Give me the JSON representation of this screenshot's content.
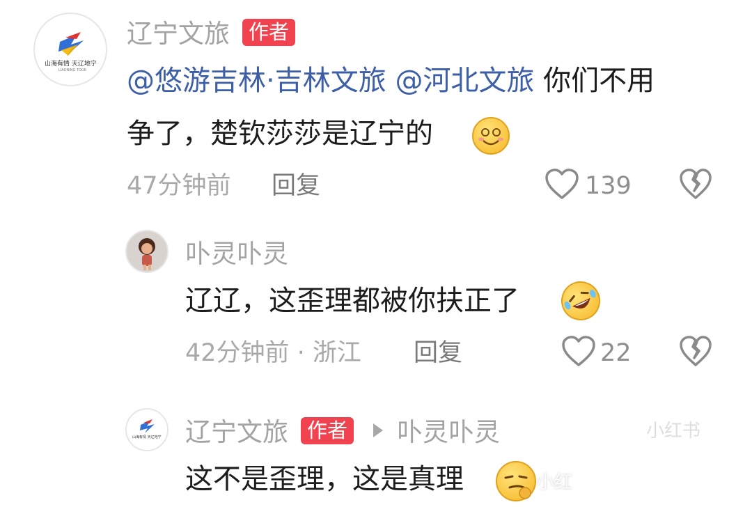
{
  "comment1": {
    "author": "辽宁文旅",
    "badge": "作者",
    "mention1": "@悠游吉林·吉林文旅",
    "mention2": "@河北文旅",
    "text_line1": "你们不用",
    "text_line2": "争了，楚钦莎莎是辽宁的",
    "emoji": "smile-emoji",
    "time": "47分钟前",
    "reply_label": "回复",
    "like_count": "139",
    "avatar_logo_text": "山海有情 天辽地宁",
    "avatar_logo_sub": "LIAONING TOUR"
  },
  "comment2": {
    "author": "卟灵卟灵",
    "text": "辽辽，这歪理都被你扶正了",
    "emoji": "rofl-emoji",
    "time": "42分钟前 · 浙江",
    "reply_label": "回复",
    "like_count": "22"
  },
  "comment3": {
    "author": "辽宁文旅",
    "badge": "作者",
    "reply_to": "卟灵卟灵",
    "text": "这不是歪理，这是真理",
    "emoji": "smirk-emoji",
    "avatar_logo_text": "山海有情 天辽地宁"
  },
  "watermark": {
    "brand": "小红书",
    "brand_small": "小红"
  },
  "colors": {
    "badge": "#f0434f",
    "mention": "#3d5fa8",
    "text": "#1c1c1c",
    "meta": "#a9a9a9"
  }
}
